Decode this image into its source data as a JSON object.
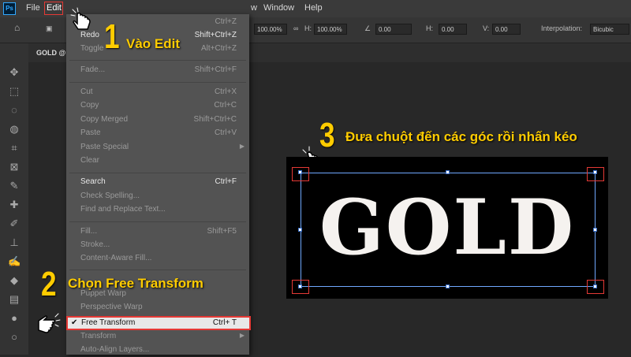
{
  "app": {
    "logo": "Ps"
  },
  "menubar": {
    "file": "File",
    "edit": "Edit",
    "view_partial": "w",
    "window": "Window",
    "help": "Help"
  },
  "options": {
    "w_val": "100.00%",
    "h_label": "H:",
    "h_val": "100.00%",
    "angle": "0.00",
    "hskew_label": "H:",
    "hskew": "0.00",
    "vskew_label": "V:",
    "vskew": "0.00",
    "interp_label": "Interpolation:",
    "interp_val": "Bicubic"
  },
  "document": {
    "tab": "GOLD @"
  },
  "menu": {
    "undo_sc": "Ctrl+Z",
    "redo": "Redo",
    "redo_sc": "Shift+Ctrl+Z",
    "toggle": "Toggle",
    "toggle_sc": "Alt+Ctrl+Z",
    "fade": "Fade...",
    "fade_sc": "Shift+Ctrl+F",
    "cut": "Cut",
    "cut_sc": "Ctrl+X",
    "copy": "Copy",
    "copy_sc": "Ctrl+C",
    "copy_merged": "Copy Merged",
    "copy_merged_sc": "Shift+Ctrl+C",
    "paste": "Paste",
    "paste_sc": "Ctrl+V",
    "paste_special": "Paste Special",
    "clear": "Clear",
    "search": "Search",
    "search_sc": "Ctrl+F",
    "check_spelling": "Check Spelling...",
    "find_replace": "Find and Replace Text...",
    "fill": "Fill...",
    "fill_sc": "Shift+F5",
    "stroke": "Stroke...",
    "content_aware": "Content-Aware Fill...",
    "puppet_warp": "Puppet Warp",
    "perspective_warp": "Perspective Warp",
    "free_transform": "Free Transform",
    "free_transform_sc": "Ctrl+ T",
    "transform": "Transform",
    "auto_align": "Auto-Align Layers..."
  },
  "annotations": {
    "step1_num": "1",
    "step1_text": "Vào Edit",
    "step2_num": "2",
    "step2_text": "Chọn Free Transform",
    "step3_num": "3",
    "step3_text": "Đưa chuột đến các góc rồi nhấn kéo"
  },
  "canvas": {
    "text": "GOLD"
  }
}
